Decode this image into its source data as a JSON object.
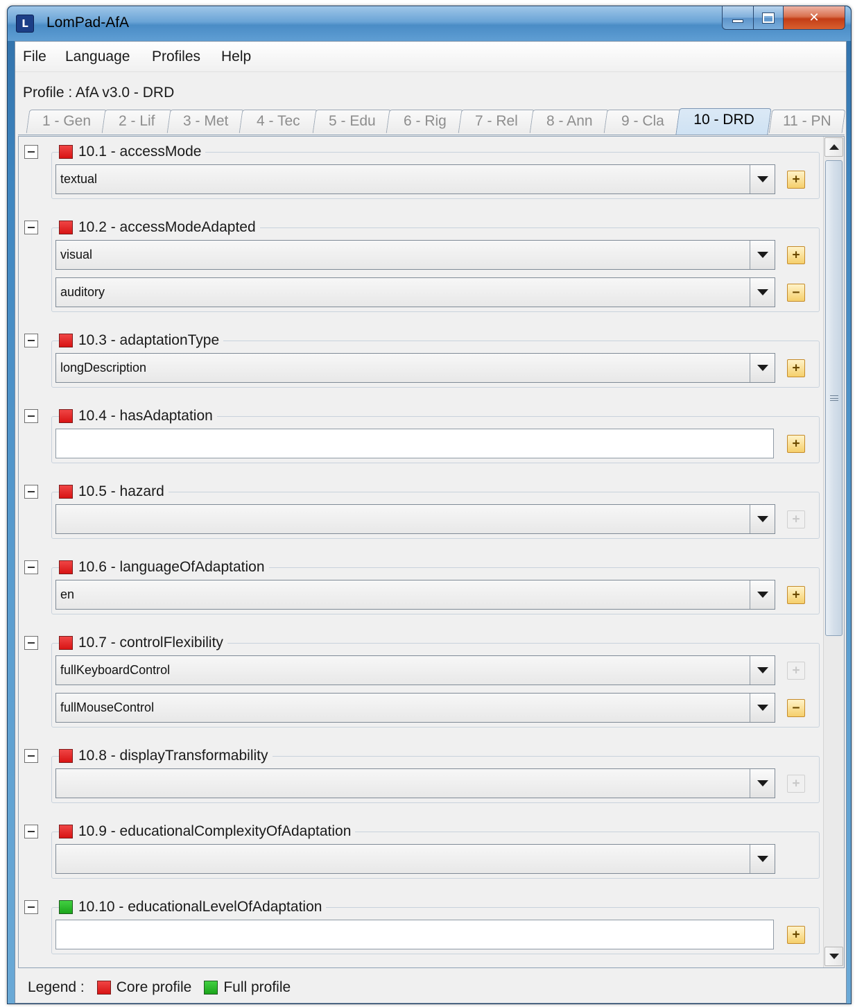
{
  "window": {
    "title": "LomPad-AfA"
  },
  "menu": [
    "File",
    "Language",
    "Profiles",
    "Help"
  ],
  "profile": {
    "label": "Profile : AfA v3.0 - DRD"
  },
  "tabs": [
    {
      "label": "1 - Gen",
      "active": false
    },
    {
      "label": "2 - Lif",
      "active": false
    },
    {
      "label": "3 - Met",
      "active": false
    },
    {
      "label": "4 - Tec",
      "active": false
    },
    {
      "label": "5 - Edu",
      "active": false
    },
    {
      "label": "6 - Rig",
      "active": false
    },
    {
      "label": "7 - Rel",
      "active": false
    },
    {
      "label": "8 - Ann",
      "active": false
    },
    {
      "label": "9 - Cla",
      "active": false
    },
    {
      "label": "10 - DRD",
      "active": true
    },
    {
      "label": "11 - PN",
      "active": false
    }
  ],
  "fields": [
    {
      "label": "10.1 - accessMode",
      "profile": "core",
      "entries": [
        {
          "kind": "combo",
          "value": "textual",
          "action": "add"
        }
      ]
    },
    {
      "label": "10.2 - accessModeAdapted",
      "profile": "core",
      "entries": [
        {
          "kind": "combo",
          "value": "visual",
          "action": "add"
        },
        {
          "kind": "combo",
          "value": "auditory",
          "action": "remove"
        }
      ]
    },
    {
      "label": "10.3 - adaptationType",
      "profile": "core",
      "entries": [
        {
          "kind": "combo",
          "value": "longDescription",
          "action": "add"
        }
      ]
    },
    {
      "label": "10.4 - hasAdaptation",
      "profile": "core",
      "entries": [
        {
          "kind": "text",
          "value": "",
          "action": "add"
        }
      ]
    },
    {
      "label": "10.5 - hazard",
      "profile": "core",
      "entries": [
        {
          "kind": "combo",
          "value": "",
          "action": "add-disabled"
        }
      ]
    },
    {
      "label": "10.6 - languageOfAdaptation",
      "profile": "core",
      "entries": [
        {
          "kind": "combo",
          "value": "en",
          "action": "add"
        }
      ]
    },
    {
      "label": "10.7 - controlFlexibility",
      "profile": "core",
      "entries": [
        {
          "kind": "combo",
          "value": "fullKeyboardControl",
          "action": "add-disabled"
        },
        {
          "kind": "combo",
          "value": "fullMouseControl",
          "action": "remove"
        }
      ]
    },
    {
      "label": "10.8 - displayTransformability",
      "profile": "core",
      "entries": [
        {
          "kind": "combo",
          "value": "",
          "action": "add-disabled"
        }
      ]
    },
    {
      "label": "10.9 - educationalComplexityOfAdaptation",
      "profile": "core",
      "entries": [
        {
          "kind": "combo",
          "value": "",
          "action": "none"
        }
      ]
    },
    {
      "label": "10.10 - educationalLevelOfAdaptation",
      "profile": "full",
      "entries": [
        {
          "kind": "text",
          "value": "",
          "action": "add"
        }
      ]
    }
  ],
  "legend": {
    "title": "Legend :",
    "core": "Core profile",
    "full": "Full profile"
  },
  "colors": {
    "core": "#e01b1b",
    "full": "#22b022",
    "action": "#f5cf6b",
    "tab_active": "#cfe2f3"
  },
  "icons": {
    "add": "plus-icon",
    "remove": "minus-icon",
    "collapse": "collapse-icon",
    "dropdown": "chevron-down-icon"
  }
}
